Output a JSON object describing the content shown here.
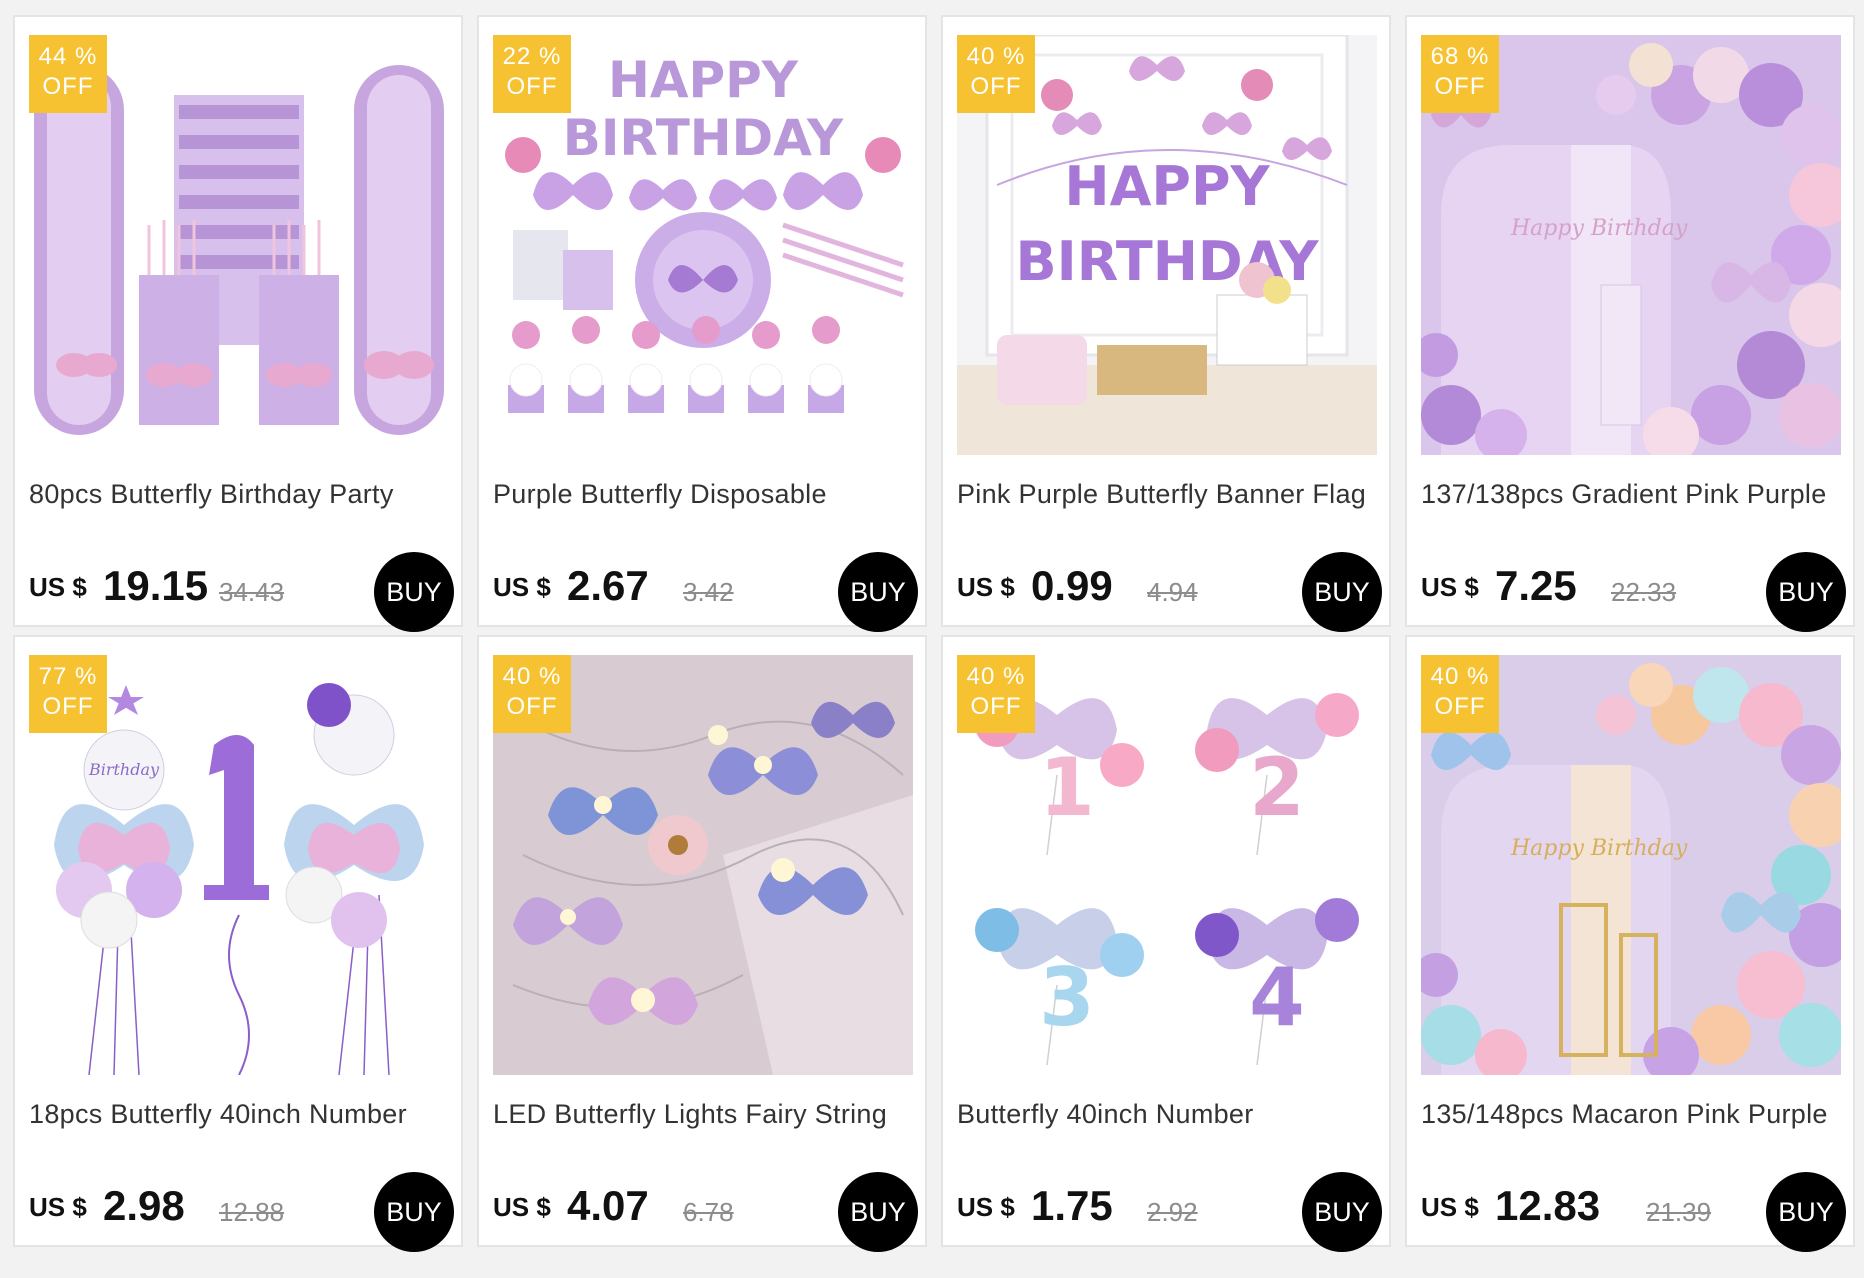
{
  "colors": {
    "badge": "#f7c232",
    "buy_button": "#000000",
    "page_background": "#f2f2f2"
  },
  "products": [
    {
      "discount_pct": "44",
      "pct_sign": "%",
      "off_label": "OFF",
      "title": "80pcs Butterfly Birthday Party",
      "currency": "US $",
      "price": "19.15",
      "old_price": "34.43",
      "buy_label": "BUY",
      "image_icon": "butterfly-tableware-set"
    },
    {
      "discount_pct": "22",
      "pct_sign": "%",
      "off_label": "OFF",
      "title": "Purple Butterfly Disposable",
      "currency": "US $",
      "price": "2.67",
      "old_price": "3.42",
      "buy_label": "BUY",
      "image_icon": "happy-birthday-banner-set",
      "image_text_1": "HAPPY",
      "image_text_2": "BIRTHDAY"
    },
    {
      "discount_pct": "40",
      "pct_sign": "%",
      "off_label": "OFF",
      "title": "Pink Purple Butterfly Banner Flag",
      "currency": "US $",
      "price": "0.99",
      "old_price": "4.94",
      "buy_label": "BUY",
      "image_icon": "banner-flag-scene",
      "image_text_1": "HAPPY",
      "image_text_2": "BIRTHDAY"
    },
    {
      "discount_pct": "68",
      "pct_sign": "%",
      "off_label": "OFF",
      "title": "137/138pcs Gradient Pink Purple",
      "currency": "US $",
      "price": "7.25",
      "old_price": "22.33",
      "buy_label": "BUY",
      "image_icon": "balloon-arch-purple",
      "image_text_1": "Happy Birthday"
    },
    {
      "discount_pct": "77",
      "pct_sign": "%",
      "off_label": "OFF",
      "title": "18pcs Butterfly 40inch Number",
      "currency": "US $",
      "price": "2.98",
      "old_price": "12.88",
      "buy_label": "BUY",
      "image_icon": "number-one-balloons",
      "image_text_1": "Birthday"
    },
    {
      "discount_pct": "40",
      "pct_sign": "%",
      "off_label": "OFF",
      "title": "LED Butterfly Lights Fairy String",
      "currency": "US $",
      "price": "4.07",
      "old_price": "6.78",
      "buy_label": "BUY",
      "image_icon": "led-butterfly-lights"
    },
    {
      "discount_pct": "40",
      "pct_sign": "%",
      "off_label": "OFF",
      "title": "Butterfly 40inch Number",
      "currency": "US $",
      "price": "1.75",
      "old_price": "2.92",
      "buy_label": "BUY",
      "image_icon": "number-balloon-sets"
    },
    {
      "discount_pct": "40",
      "pct_sign": "%",
      "off_label": "OFF",
      "title": "135/148pcs Macaron Pink Purple",
      "currency": "US $",
      "price": "12.83",
      "old_price": "21.39",
      "buy_label": "BUY",
      "image_icon": "balloon-arch-macaron",
      "image_text_1": "Happy Birthday"
    }
  ]
}
